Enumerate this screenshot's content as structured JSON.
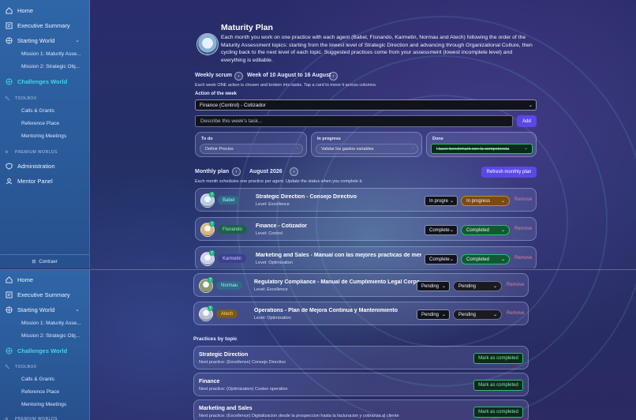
{
  "sidebar": {
    "home": "Home",
    "executive_summary": "Executive Summary",
    "starting_world": "Starting World",
    "missions": [
      "Mission 1: Maturity Asse...",
      "Mission 2: Strategic Obj..."
    ],
    "challenges_world": "Challenges World",
    "toolbox_label": "TOOLBOX",
    "toolbox_items": [
      "Calls & Grants",
      "Reference Place",
      "Mentoring Meetings"
    ],
    "premium_label": "PREMIUM WORLDS",
    "administration": "Administration",
    "mentor_panel": "Mentor Panel",
    "collapse": "Contraer"
  },
  "header": {
    "title": "Maturity Plan",
    "description": "Each month you work on one practice with each agent (Babel, Fisnando, Karmetin, Normau and Atech) following the order of the Maturity Assessment topics: starting from the lowest level of Strategic Direction and advancing through Organizational Culture, then cycling back to the next level of each topic. Suggested practices come from your assessment (lowest incomplete level) and everything is editable."
  },
  "weekly": {
    "label": "Weekly scrum",
    "week": "Week of 10 August to 16 August",
    "hint": "Each week ONE action is chosen and broken into tasks. Tap a card to move it across columns.",
    "action_label": "Action of the week",
    "action_value": "Finance (Control) - Cotizador",
    "task_placeholder": "Describe this week's task...",
    "add_button": "Add",
    "columns": [
      {
        "title": "To do",
        "task": "Definir Precios"
      },
      {
        "title": "In progress",
        "task": "Validar los gastos variables"
      },
      {
        "title": "Done",
        "task": "Hacer benchmark con la competencia"
      }
    ]
  },
  "monthly": {
    "label": "Monthly plan",
    "month": "August 2026",
    "refresh_button": "Refresh monthly plan",
    "hint": "Each month schedules one practice per agent. Update the status when you complete it.",
    "remove_label": "Remove",
    "rows": [
      {
        "agent": "Babel",
        "title": "Strategic Direction - Consejo Directivo",
        "level": "Level: Excellence",
        "select": "In progre",
        "status": "In progress",
        "status_color": "#7a4a12",
        "tag_color": "#2f6a86",
        "tag_text_color": "#9ff0ff",
        "avatar_color": "#b7cde6"
      },
      {
        "agent": "Fisnando",
        "title": "Finance - Cotizador",
        "level": "Level: Control",
        "select": "Complete",
        "status": "Completed",
        "status_color": "#0f5a33",
        "tag_color": "#20604a",
        "tag_text_color": "#8ef0c4",
        "avatar_color": "#d9b67a"
      },
      {
        "agent": "Karmetin",
        "title": "Marketing and Sales - Manual con las mejores practicas de mer...",
        "level": "Level: Optimization",
        "select": "Complete",
        "status": "Completed",
        "status_color": "#0f5a33",
        "tag_color": "#3b3f8e",
        "tag_text_color": "#c8ccff",
        "avatar_color": "#c9cfe8"
      },
      {
        "agent": "Normau",
        "title": "Regulatory Compliance - Manual de Cumplimiento Legal Corpor...",
        "level": "Level: Excellence",
        "select": "Pending",
        "status": "Pending",
        "status_color": "#1a1b22",
        "tag_color": "#2f6a86",
        "tag_text_color": "#9ff0ff",
        "avatar_color": "#8a9a6a"
      },
      {
        "agent": "Atech",
        "title": "Operations - Plan de Mejora Continua y Mantenimiento",
        "level": "Level: Optimization",
        "select": "Pending",
        "status": "Pending",
        "status_color": "#1a1b22",
        "tag_color": "#7a5a1e",
        "tag_text_color": "#ffd58a",
        "avatar_color": "#b9c0cf"
      }
    ]
  },
  "practices": {
    "label": "Practices by topic",
    "mark_button": "Mark as completed",
    "items": [
      {
        "title": "Strategic Direction",
        "next": "Next practice: (Excellence) Consejo Directivo"
      },
      {
        "title": "Finance",
        "next": "Next practice: (Optimization) Costeo operativo"
      },
      {
        "title": "Marketing and Sales",
        "next": "Next practice: (Excellence) Digitalizacion desde la prospeccion hasta la facturacion y cobranza al cliente"
      }
    ]
  },
  "colors": {
    "sidebar": "#2f66a8",
    "accent": "#5a48e6",
    "active_world": "#3fd6e6",
    "completed_border": "#27c26b",
    "remove": "#e07d95"
  }
}
